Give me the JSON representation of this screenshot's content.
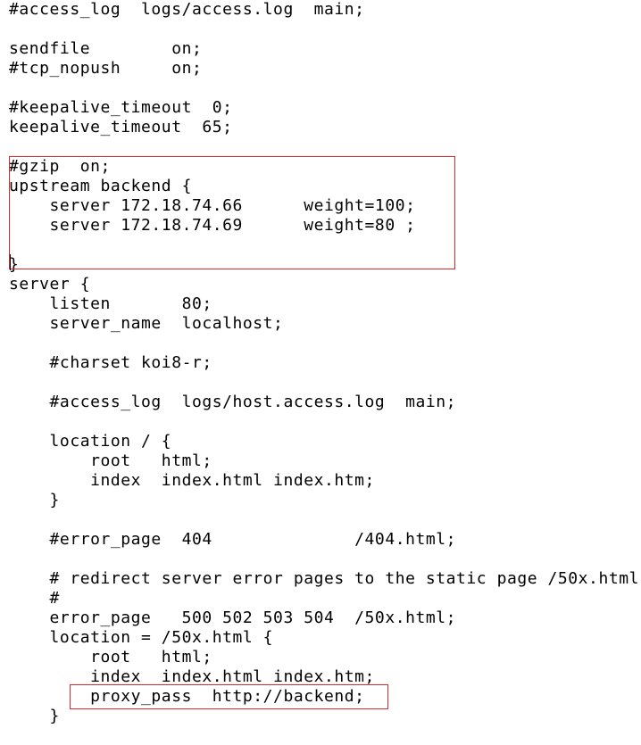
{
  "editor": {
    "lines": [
      "#access_log  logs/access.log  main;",
      "",
      "sendfile        on;",
      "#tcp_nopush     on;",
      "",
      "#keepalive_timeout  0;",
      "keepalive_timeout  65;",
      "",
      "#gzip  on;",
      "upstream backend {",
      "    server 172.18.74.66      weight=100;",
      "    server 172.18.74.69      weight=80 ;",
      "",
      "}",
      "server {",
      "    listen       80;",
      "    server_name  localhost;",
      "",
      "    #charset koi8-r;",
      "",
      "    #access_log  logs/host.access.log  main;",
      "",
      "    location / {",
      "        root   html;",
      "        index  index.html index.htm;",
      "    }",
      "",
      "    #error_page  404              /404.html;",
      "",
      "    # redirect server error pages to the static page /50x.html",
      "    #",
      "    error_page   500 502 503 504  /50x.html;",
      "    location = /50x.html {",
      "        root   html;",
      "        index  index.html index.htm;",
      "        proxy_pass  http://backend;",
      "    }"
    ]
  },
  "highlights": {
    "color": "#d9262b",
    "upstream_block": "upstream backend",
    "proxy_line": "proxy_pass  http://backend;"
  }
}
